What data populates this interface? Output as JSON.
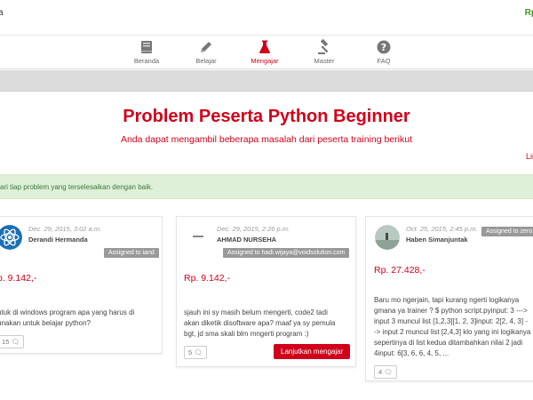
{
  "topbar": {
    "brand_fragment": "a",
    "balance_fragment": "Rp"
  },
  "nav": {
    "items": [
      {
        "label": "Beranda",
        "icon": "book-icon"
      },
      {
        "label": "Belajar",
        "icon": "pencil-icon"
      },
      {
        "label": "Mengajar",
        "icon": "flask-icon",
        "active": true
      },
      {
        "label": "Master",
        "icon": "gavel-icon"
      },
      {
        "label": "FAQ",
        "icon": "question-circle-icon"
      }
    ]
  },
  "header": {
    "title": "Problem Peserta Python Beginner",
    "subtitle": "Anda dapat mengambil beberapa masalah dari peserta training berikut",
    "corner_link": "Lin"
  },
  "alert": {
    "text": "ari tiap problem yang terselesaikan dengan baik."
  },
  "cards": [
    {
      "date": "Dec. 29, 2015, 3:02 a.m.",
      "user": "Derandi Hermanda",
      "assigned": "Assigned to iand",
      "price": "p. 9.142,-",
      "desc_lines": [
        "ntuk di windows program apa yang harus di",
        "unakan untuk belajar python?"
      ],
      "count": "15"
    },
    {
      "date": "Dec. 29, 2015, 2:26 p.m.",
      "user": "AHMAD NURSEHA",
      "assigned": "Assigned to hadi.wijaya@voidsolution.com",
      "price": "Rp. 9.142,-",
      "desc_lines": [
        "sjauh ini sy masih belum mengerti, code2 tadi",
        "akan diketik disoftware apa? maaf ya sy pemula",
        "bgt, jd sma skali blm mngerti program :)"
      ],
      "count": "5",
      "cta": "Lanjutkan mengajar"
    },
    {
      "date": "Oct. 25, 2015, 2:45 p.m.",
      "user": "Haben Simanjuntak",
      "assigned": "Assigned to zero",
      "price": "Rp. 27.428,-",
      "desc_lines": [
        "Baru mo ngerjain, tapi kurang ngerti logikanya",
        "gmana ya trainer ? $ python script.pyinput: 3 --->",
        "input 3 muncul list [1,2,3][1, 2, 3]input: 2[2, 4, 3] -",
        "-> input 2 muncul list [2,4,3] klo yang ini logikanya",
        "sepertinya di list kedua ditambahkan nilai 2 jadi",
        "4input: 6[3, 6, 6, 4, 5, ..."
      ],
      "count": "4"
    }
  ],
  "colors": {
    "accent": "#d0021b",
    "alert_bg": "#dff0d8",
    "alert_text": "#3c763d",
    "badge": "#999999"
  }
}
